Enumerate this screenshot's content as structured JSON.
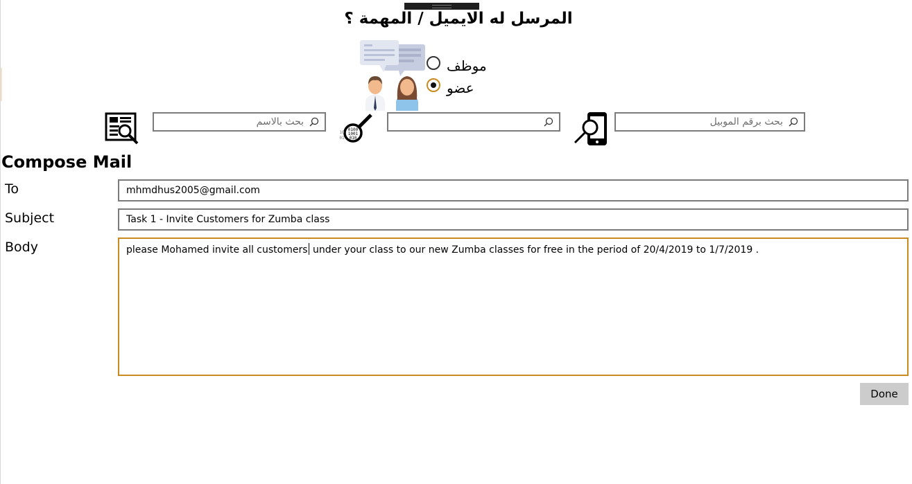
{
  "header": {
    "question": "المرسل له الايميل / المهمة ؟"
  },
  "recipient_type": {
    "options": [
      {
        "label": "موظف",
        "selected": false
      },
      {
        "label": "عضو",
        "selected": true
      }
    ]
  },
  "search": {
    "by_name_placeholder": "بحث بالاسم",
    "by_code_placeholder": "",
    "by_mobile_placeholder": "بحث برقم الموبيل"
  },
  "compose": {
    "title": "Compose Mail",
    "to_label": "To",
    "to_value": "mhmdhus2005@gmail.com",
    "subject_label": "Subject",
    "subject_value": "Task 1 - Invite Customers for Zumba class",
    "body_label": "Body",
    "body_before_caret": "please Mohamed invite all customers",
    "body_after_caret": " under your class to our new Zumba classes for free in the period of 20/4/2019 to 1/7/2019 .",
    "done_label": "Done"
  },
  "colors": {
    "accent": "#c98a1f",
    "border": "#7a7a7a",
    "button_bg": "#cccccc"
  },
  "icons": [
    "document-search-icon",
    "binary-search-icon",
    "mobile-search-icon",
    "people-chat-icon",
    "magnifier-icon"
  ]
}
